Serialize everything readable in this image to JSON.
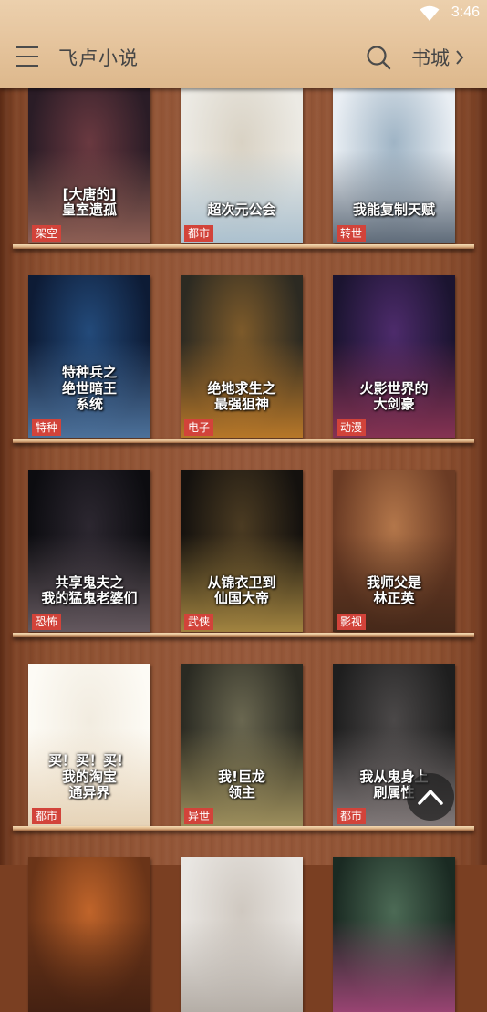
{
  "status_bar": {
    "time": "3:46"
  },
  "app_bar": {
    "title": "飞卢小说",
    "store_label": "书城"
  },
  "shelves": [
    {
      "books": [
        {
          "cover_text": "[大唐的]\n皇室遗孤",
          "tag": "架空",
          "colors": [
            "#2a1c26",
            "#6a3940",
            "#a77060"
          ]
        },
        {
          "cover_text": "超次元公会",
          "tag": "都市",
          "colors": [
            "#eceae4",
            "#d9d2c4",
            "#9bb6c9"
          ]
        },
        {
          "cover_text": "我能复制天赋",
          "tag": "转世",
          "colors": [
            "#e9eef3",
            "#9fb4c5",
            "#3c4a5a"
          ]
        }
      ]
    },
    {
      "books": [
        {
          "cover_text": "特种兵之\n绝世暗王\n系统",
          "tag": "特种",
          "colors": [
            "#0d1b35",
            "#234a7a",
            "#5c86b3"
          ]
        },
        {
          "cover_text": "绝地求生之\n最强狙神",
          "tag": "电子",
          "colors": [
            "#2c2a22",
            "#7d5a2a",
            "#d98a2a"
          ]
        },
        {
          "cover_text": "火影世界的\n大剑豪",
          "tag": "动漫",
          "colors": [
            "#1b1430",
            "#4d2b6b",
            "#a03a5b"
          ]
        }
      ]
    },
    {
      "books": [
        {
          "cover_text": "共享鬼夫之\n我的猛鬼老婆们",
          "tag": "恐怖",
          "colors": [
            "#0c0c10",
            "#2c2730",
            "#7a6b72"
          ]
        },
        {
          "cover_text": "从锦衣卫到\n仙国大帝",
          "tag": "武侠",
          "colors": [
            "#14110e",
            "#4b3b22",
            "#c5a04c"
          ]
        },
        {
          "cover_text": "我师父是\n林正英",
          "tag": "影视",
          "colors": [
            "#6b3b24",
            "#b3764a",
            "#3d2417"
          ]
        }
      ]
    },
    {
      "books": [
        {
          "cover_text": "买！买！买！\n我的淘宝\n通异界",
          "tag": "都市",
          "colors": [
            "#fdfbf5",
            "#f2ece0",
            "#e0c9a8"
          ]
        },
        {
          "cover_text": "我!巨龙\n领主",
          "tag": "异世",
          "colors": [
            "#2a2a22",
            "#6a6750",
            "#b9a76a"
          ]
        },
        {
          "cover_text": "我从鬼身上\n刷属性",
          "tag": "都市",
          "colors": [
            "#1e1e1e",
            "#4b4848",
            "#9a9090"
          ]
        }
      ]
    },
    {
      "books": [
        {
          "cover_text": "",
          "tag": "",
          "colors": [
            "#6a3418",
            "#c0642a",
            "#3b1c10"
          ]
        },
        {
          "cover_text": "",
          "tag": "",
          "colors": [
            "#e9e6e2",
            "#cfc8c0",
            "#a8a098"
          ]
        },
        {
          "cover_text": "",
          "tag": "",
          "colors": [
            "#1a2a22",
            "#4c6a55",
            "#b84a86"
          ]
        }
      ]
    }
  ],
  "colors": {
    "appbar": "#e6c59e",
    "tag": "#d2433a",
    "shelf": "#8d5030"
  }
}
